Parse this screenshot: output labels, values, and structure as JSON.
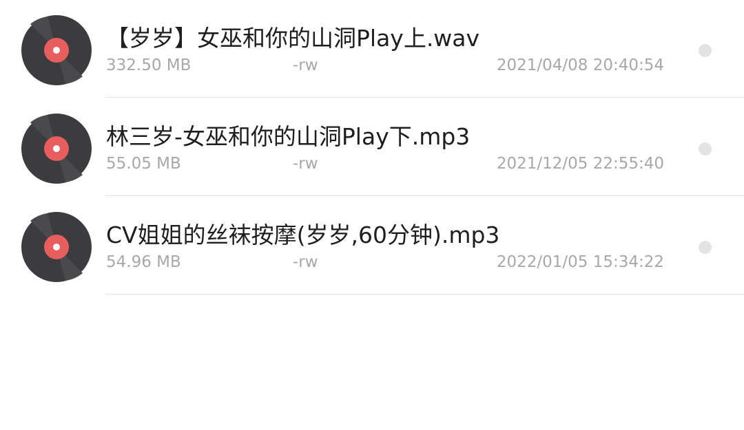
{
  "files": [
    {
      "name": "【岁岁】女巫和你的山洞Play上.wav",
      "size": "332.50 MB",
      "permissions": "-rw",
      "modified": "2021/04/08 20:40:54",
      "icon": "vinyl-disc-icon"
    },
    {
      "name": "林三岁-女巫和你的山洞Play下.mp3",
      "size": "55.05 MB",
      "permissions": "-rw",
      "modified": "2021/12/05 22:55:40",
      "icon": "vinyl-disc-icon"
    },
    {
      "name": "CV姐姐的丝袜按摩(岁岁,60分钟).mp3",
      "size": "54.96 MB",
      "permissions": "-rw",
      "modified": "2022/01/05 15:34:22",
      "icon": "vinyl-disc-icon"
    }
  ],
  "colors": {
    "disc": "#3c3c3e",
    "disc_label": "#e85e5e",
    "disc_hole": "#ffffff",
    "primary_text": "#1e1e1e",
    "secondary_text": "#a8a8a8",
    "select_dot": "#e3e3e3"
  }
}
